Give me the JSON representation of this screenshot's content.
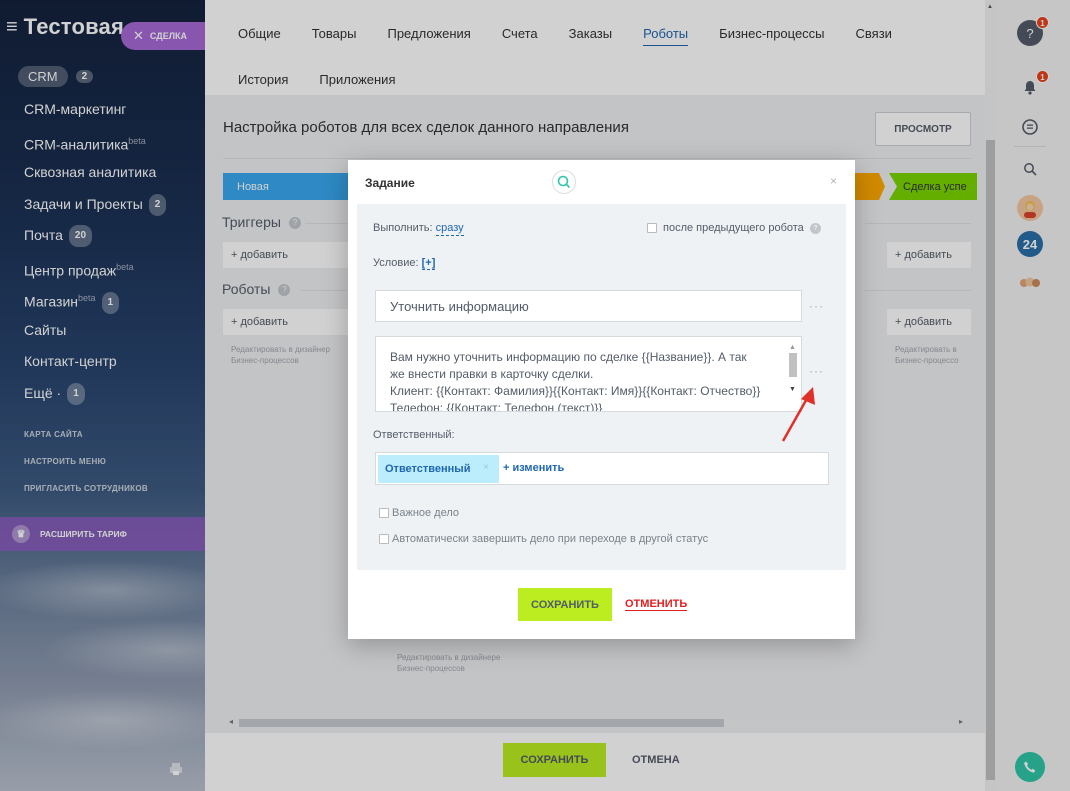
{
  "sidebar": {
    "title": "Тестовая",
    "chip_label": "СДЕЛКА",
    "crm_label": "CRM",
    "crm_count": "2",
    "items": [
      {
        "label": "CRM-маркетинг",
        "sup": "",
        "count": ""
      },
      {
        "label": "CRM-аналитика",
        "sup": "beta",
        "count": ""
      },
      {
        "label": "Сквозная аналитика",
        "sup": "",
        "count": ""
      },
      {
        "label": "Задачи и Проекты",
        "sup": "",
        "count": "2"
      },
      {
        "label": "Почта",
        "sup": "",
        "count": "20"
      },
      {
        "label": "Центр продаж",
        "sup": "beta",
        "count": ""
      },
      {
        "label": "Магазин",
        "sup": "beta",
        "count": "1"
      },
      {
        "label": "Сайты",
        "sup": "",
        "count": ""
      },
      {
        "label": "Контакт-центр",
        "sup": "",
        "count": ""
      },
      {
        "label": "Ещё ·",
        "sup": "",
        "count": "1"
      }
    ],
    "small_links": [
      "КАРТА САЙТА",
      "НАСТРОИТЬ МЕНЮ",
      "ПРИГЛАСИТЬ СОТРУДНИКОВ"
    ],
    "tariff_label": "РАСШИРИТЬ ТАРИФ"
  },
  "tabs": [
    {
      "label": "Общие",
      "active": false
    },
    {
      "label": "Товары",
      "active": false
    },
    {
      "label": "Предложения",
      "active": false
    },
    {
      "label": "Счета",
      "active": false
    },
    {
      "label": "Заказы",
      "active": false
    },
    {
      "label": "Роботы",
      "active": true
    },
    {
      "label": "Бизнес-процессы",
      "active": false
    },
    {
      "label": "Связи",
      "active": false
    },
    {
      "label": "История",
      "active": false
    },
    {
      "label": "Приложения",
      "active": false
    }
  ],
  "page": {
    "settings_title": "Настройка роботов для всех сделок данного направления",
    "view_button": "ПРОСМОТР",
    "stage_new": "Новая",
    "stage_success": "Сделка успе",
    "triggers_label": "Триггеры",
    "robots_label": "Роботы",
    "add_label": "+ добавить",
    "edit_note_line1": "Редактировать в дизайнер",
    "edit_note_line2": "Бизнес-процессов",
    "edit_note_right_line1": "Редактировать в",
    "edit_note_right_line2": "Бизнес-процессо",
    "edit_note_bottom_line1": "Редактировать в дизайнере",
    "edit_note_bottom_line2": "Бизнес-процессов",
    "save_button": "СОХРАНИТЬ",
    "cancel_button": "ОТМЕНА"
  },
  "right_panel": {
    "help_count": "1",
    "notif_count": "1",
    "b24_label": "24"
  },
  "modal": {
    "title": "Задание",
    "execute_label": "Выполнить:",
    "execute_value": "сразу",
    "after_prev_label": "после предыдущего робота",
    "condition_label": "Условие:",
    "condition_add": "[+]",
    "task_title": "Уточнить информацию",
    "description_lines": [
      "Вам нужно уточнить информацию по сделке {{Название}}. А так",
      "же внести правки в карточку сделки.",
      "Клиент: {{Контакт: Фамилия}}{{Контакт: Имя}}{{Контакт: Отчество}}",
      "Телефон: {{Контакт: Телефон (текст)}}"
    ],
    "responsible_label": "Ответственный:",
    "responsible_chip": "Ответственный",
    "responsible_change": "+ изменить",
    "important_label": "Важное дело",
    "auto_complete_label": "Автоматически завершить дело при переходе в другой статус",
    "save_button": "СОХРАНИТЬ",
    "cancel_button": "ОТМЕНИТЬ"
  },
  "colors": {
    "accent_blue": "#2067b0",
    "stage_new": "#39a8ef",
    "stage_orange": "#ffa900",
    "stage_success": "#7bd500",
    "save_green": "#bbed21",
    "cancel_red": "#e02020",
    "arrow_red": "#e0302a"
  }
}
